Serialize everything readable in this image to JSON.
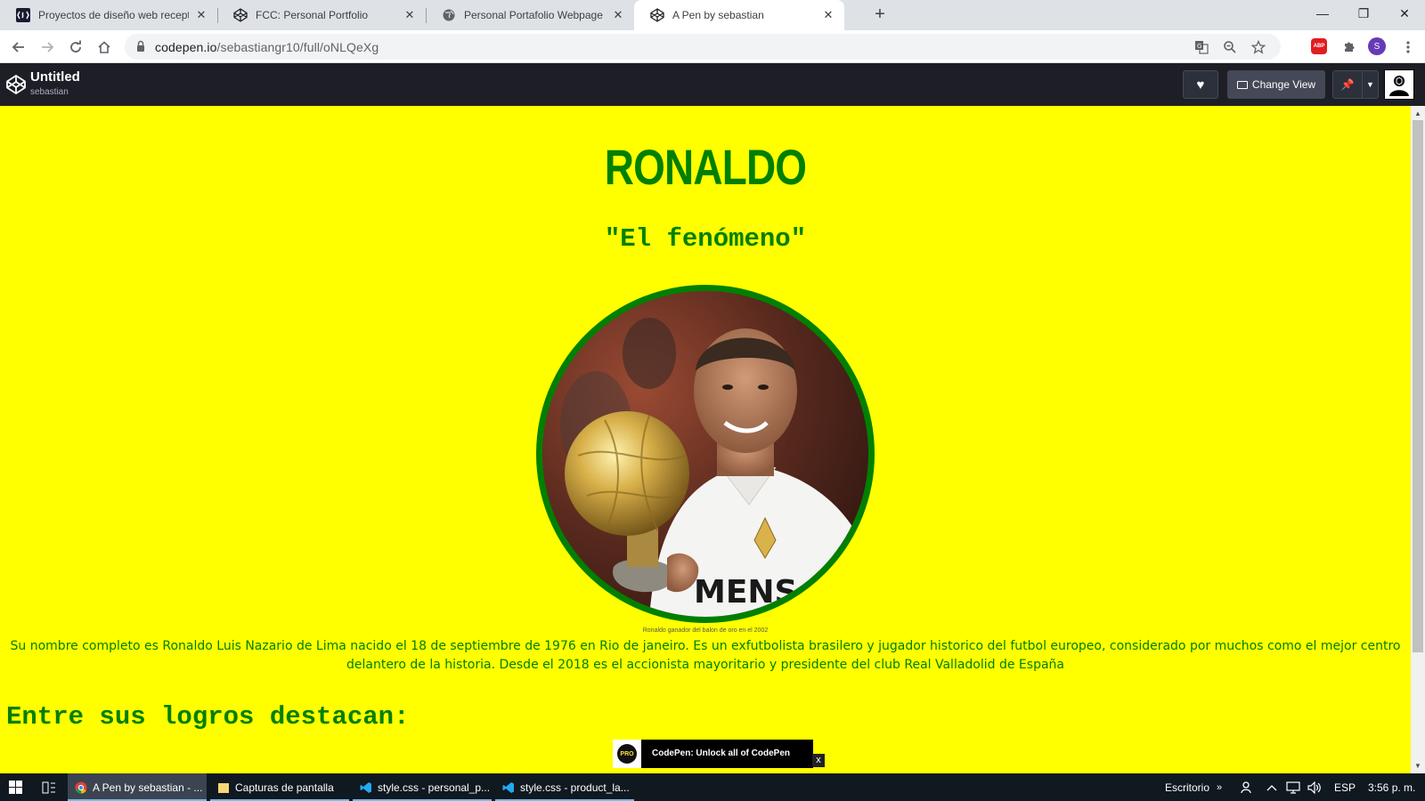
{
  "browser": {
    "tabs": [
      {
        "title": "Proyectos de diseño web recepti",
        "icon": "fcc-icon"
      },
      {
        "title": "FCC: Personal Portfolio",
        "icon": "codepen-icon"
      },
      {
        "title": "Personal Portafolio Webpage",
        "icon": "globe-icon"
      },
      {
        "title": "A Pen by sebastian",
        "icon": "codepen-icon",
        "active": true
      }
    ],
    "url_host": "codepen.io",
    "url_path": "/sebastiangr10/full/oNLQeXg",
    "profile_initial": "S",
    "abp_label": "ABP"
  },
  "codepen": {
    "title": "Untitled",
    "author": "sebastian",
    "change_view_label": "Change View"
  },
  "page": {
    "title": "RONALDO",
    "subtitle": "\"El fenómeno\"",
    "image_caption": "Ronaldo ganador del balon de oro en el 2002",
    "bio": "Su nombre completo es Ronaldo Luis Nazario de Lima nacido el 18 de septiembre de 1976 en Rio de janeiro. Es un exfutbolista brasilero y jugador historico del futbol europeo, considerado por muchos como el mejor centro delantero de la historia. Desde el 2018 es el accionista mayoritario y presidente del club Real Valladolid de España",
    "section_heading": "Entre sus logros destacan:",
    "jersey_text": "MENS"
  },
  "pro_banner": {
    "badge": "PRO",
    "text": "CodePen: Unlock all of CodePen",
    "close": "x"
  },
  "taskbar": {
    "items": [
      {
        "label": "A Pen by sebastian - ...",
        "icon": "chrome-icon",
        "active": true
      },
      {
        "label": "Capturas de pantalla",
        "icon": "folder-icon"
      },
      {
        "label": "style.css - personal_p...",
        "icon": "vscode-icon"
      },
      {
        "label": "style.css - product_la...",
        "icon": "vscode-icon"
      }
    ],
    "desktop_label": "Escritorio",
    "language": "ESP",
    "time": "3:56 p. m."
  },
  "colors": {
    "page_bg": "#ffff00",
    "accent_green": "#008000",
    "codepen_bar": "#1e1f26"
  }
}
